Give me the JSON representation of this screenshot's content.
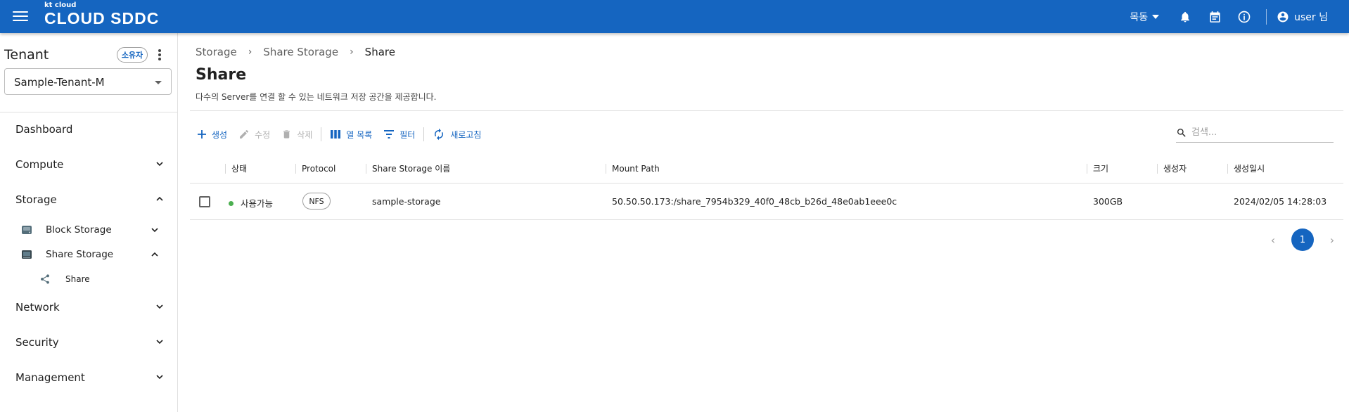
{
  "colors": {
    "brand": "#1565c0",
    "status_available": "#4caf50"
  },
  "header": {
    "logo_small": "kt cloud",
    "logo_big": "CLOUD SDDC",
    "location": "목동",
    "user": "user 님",
    "icons": [
      "menu-icon",
      "bell-icon",
      "calendar-icon",
      "info-icon",
      "account-circle-icon"
    ]
  },
  "sidebar": {
    "tenant_title": "Tenant",
    "owner_badge": "소유자",
    "tenant_selected": "Sample-Tenant-M",
    "items": [
      {
        "label": "Dashboard"
      },
      {
        "label": "Compute"
      },
      {
        "label": "Storage",
        "expanded": true,
        "children": [
          {
            "label": "Block Storage"
          },
          {
            "label": "Share Storage",
            "expanded": true,
            "children": [
              {
                "label": "Share"
              }
            ]
          }
        ]
      },
      {
        "label": "Network"
      },
      {
        "label": "Security"
      },
      {
        "label": "Management"
      }
    ]
  },
  "breadcrumb": [
    "Storage",
    "Share Storage",
    "Share"
  ],
  "page": {
    "title": "Share",
    "description": "다수의 Server를 연결 할 수 있는 네트워크 저장 공간을 제공합니다."
  },
  "toolbar": {
    "create": "생성",
    "edit": "수정",
    "delete": "삭제",
    "columns": "열 목록",
    "filter": "필터",
    "refresh": "새로고침",
    "search_placeholder": "검색..."
  },
  "table": {
    "columns": [
      "상태",
      "Protocol",
      "Share Storage 이름",
      "Mount Path",
      "크기",
      "생성자",
      "생성일시"
    ],
    "rows": [
      {
        "status": "사용가능",
        "protocol": "NFS",
        "name": "sample-storage",
        "mount_path": "50.50.50.173:/share_7954b329_40f0_48cb_b26d_48e0ab1eee0c",
        "size": "300GB",
        "creator": "",
        "created_at": "2024/02/05 14:28:03"
      }
    ]
  },
  "pagination": {
    "current": "1"
  }
}
